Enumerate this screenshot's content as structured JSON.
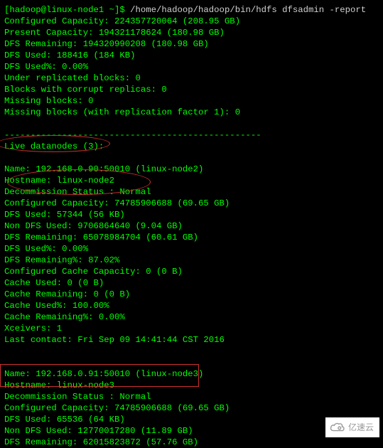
{
  "prompt": {
    "user_host": "[hadoop@linux-node1 ~]$",
    "command": " /home/hadoop/hadoop/bin/hdfs dfsadmin -report"
  },
  "summary": {
    "configured_capacity": "Configured Capacity: 224357720064 (208.95 GB)",
    "present_capacity": "Present Capacity: 194321178624 (180.98 GB)",
    "dfs_remaining": "DFS Remaining: 194320990208 (180.98 GB)",
    "dfs_used": "DFS Used: 188416 (184 KB)",
    "dfs_used_pct": "DFS Used%: 0.00%",
    "under_replicated": "Under replicated blocks: 0",
    "corrupt_replicas": "Blocks with corrupt replicas: 0",
    "missing_blocks": "Missing blocks: 0",
    "missing_blocks_rf1": "Missing blocks (with replication factor 1): 0"
  },
  "separator": "-------------------------------------------------",
  "live_datanodes": "Live datanodes (3):",
  "node1": {
    "name": "Name: 192.168.0.90:50010 (linux-node2)",
    "hostname": "Hostname: linux-node2",
    "decommission": "Decommission Status : Normal",
    "configured_capacity": "Configured Capacity: 74785906688 (69.65 GB)",
    "dfs_used": "DFS Used: 57344 (56 KB)",
    "non_dfs_used": "Non DFS Used: 9706864640 (9.04 GB)",
    "dfs_remaining": "DFS Remaining: 65078984704 (60.61 GB)",
    "dfs_used_pct": "DFS Used%: 0.00%",
    "dfs_remaining_pct": "DFS Remaining%: 87.02%",
    "cache_capacity": "Configured Cache Capacity: 0 (0 B)",
    "cache_used": "Cache Used: 0 (0 B)",
    "cache_remaining": "Cache Remaining: 0 (0 B)",
    "cache_used_pct": "Cache Used%: 100.00%",
    "cache_remaining_pct": "Cache Remaining%: 0.00%",
    "xceivers": "Xceivers: 1",
    "last_contact": "Last contact: Fri Sep 09 14:41:44 CST 2016"
  },
  "node2": {
    "name": "Name: 192.168.0.91:50010 (linux-node3)",
    "hostname": "Hostname: linux-node3",
    "decommission": "Decommission Status : Normal",
    "configured_capacity": "Configured Capacity: 74785906688 (69.65 GB)",
    "dfs_used": "DFS Used: 65536 (64 KB)",
    "non_dfs_used": "Non DFS Used: 12770017280 (11.89 GB)",
    "dfs_remaining": "DFS Remaining: 62015823872 (57.76 GB)"
  },
  "watermark": "亿速云"
}
